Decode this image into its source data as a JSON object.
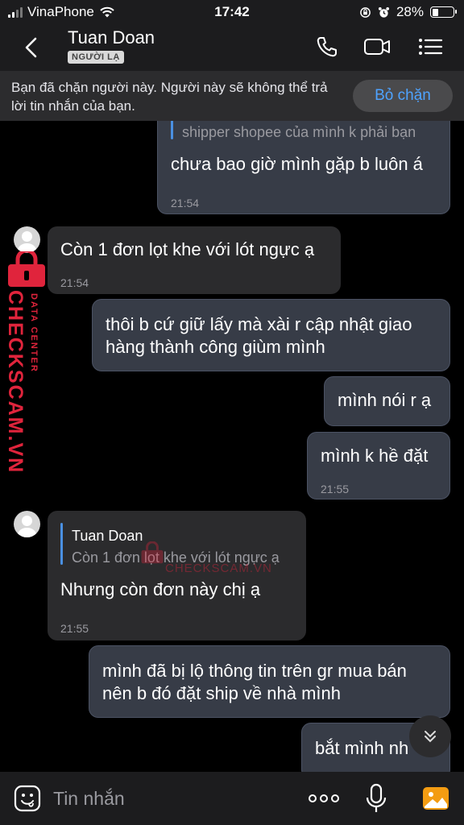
{
  "status_bar": {
    "carrier": "VinaPhone",
    "time": "17:42",
    "battery": "28%",
    "battery_level": 0.28
  },
  "header": {
    "contact_name": "Tuan Doan",
    "badge": "NGƯỜI LẠ",
    "icons": [
      "back-chevron-icon",
      "phone-icon",
      "video-camera-icon",
      "list-menu-icon"
    ]
  },
  "banner": {
    "text": "Bạn đã chặn người này. Người này sẽ không thể trả lời tin nhắn của bạn.",
    "button": "Bỏ chặn"
  },
  "messages": [
    {
      "direction": "out",
      "quote": "shipper shopee của mình k phải bạn",
      "text": "chưa bao giờ mình gặp b luôn á",
      "time": "21:54"
    },
    {
      "direction": "in",
      "text": "Còn 1 đơn lọt khe với lót ngực ạ",
      "time": "21:54"
    },
    {
      "direction": "out",
      "text": "thôi b cứ giữ lấy mà xài r cập nhật giao hàng thành công giùm mình",
      "line1": "thôi b cứ giữ lấy mà xài r cập nhật giao",
      "line2": "hàng thành công giùm mình"
    },
    {
      "direction": "out",
      "text": "mình nói r ạ"
    },
    {
      "direction": "out",
      "text": "mình k hề đặt",
      "time": "21:55"
    },
    {
      "direction": "in",
      "quote_author": "Tuan Doan",
      "quote": "Còn 1 đơn lọt khe với lót ngực ạ",
      "text": "Nhưng còn đơn này chị ạ",
      "time": "21:55"
    },
    {
      "direction": "out",
      "text": "mình đã bị lộ thông tin trên gr mua bán nên b đó đặt ship về nhà mình",
      "line1": "mình đã bị lộ thông tin trên gr mua bán",
      "line2": "nên b đó đặt ship về nhà mình"
    },
    {
      "direction": "out",
      "text": "bắt mình nh"
    }
  ],
  "watermark": {
    "brand": "CHECKSCAM.VN",
    "sub": "DATA CENTER"
  },
  "input_bar": {
    "placeholder": "Tin nhắn",
    "icons": [
      "sticker-icon",
      "more-dots-icon",
      "microphone-icon",
      "photo-icon"
    ]
  },
  "colors": {
    "accent": "#4ea3ff",
    "quote_bar": "#4a90e2",
    "outgoing_bubble": "#373c47",
    "incoming_bubble": "#2b2b2d",
    "watermark": "#e0243c"
  }
}
